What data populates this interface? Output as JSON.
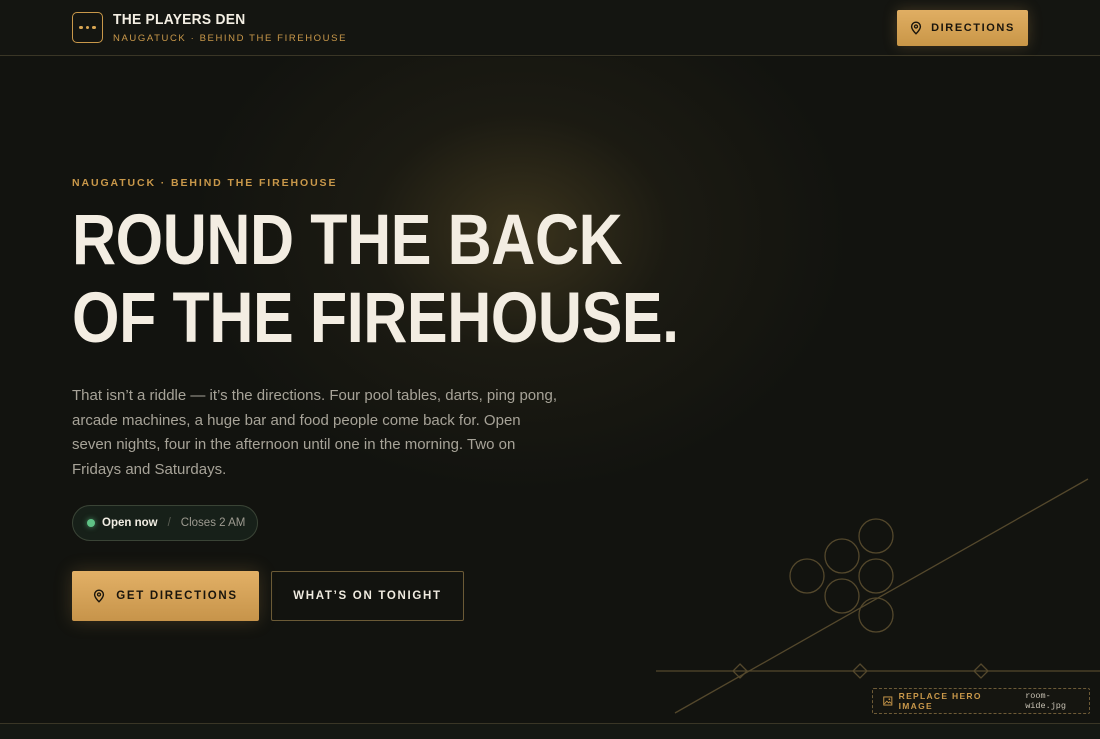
{
  "header": {
    "brand_name": "THE PLAYERS DEN",
    "brand_sub": "NAUGATUCK · BEHIND THE FIREHOUSE",
    "directions_label": "DIRECTIONS"
  },
  "hero": {
    "eyebrow": "NAUGATUCK · BEHIND THE FIREHOUSE",
    "headline_line1": "ROUND THE BACK",
    "headline_line2": "OF THE FIREHOUSE.",
    "lede": "That isn’t a riddle — it’s the directions. Four pool tables, darts, ping pong, arcade machines, a huge bar and food people come back for. Open seven nights, four in the afternoon until one in the morning. Two on Fridays and Saturdays.",
    "status": {
      "open_label": "Open now",
      "separator": "/",
      "closes_label": "Closes 2 AM"
    },
    "primary_button": "GET DIRECTIONS",
    "secondary_button": "WHAT’S ON TONIGHT",
    "replace_image": {
      "label": "REPLACE HERO IMAGE",
      "filename": "room-wide.jpg"
    }
  },
  "icons": {
    "menu": "menu-dots-icon",
    "pin": "map-pin-icon",
    "image": "image-icon",
    "status": "status-dot-icon"
  },
  "colors": {
    "background": "#12130f",
    "accent_gold": "#d9a653",
    "text_light": "#f3ede2",
    "text_muted": "#a7a398",
    "status_green": "#5fc286"
  }
}
